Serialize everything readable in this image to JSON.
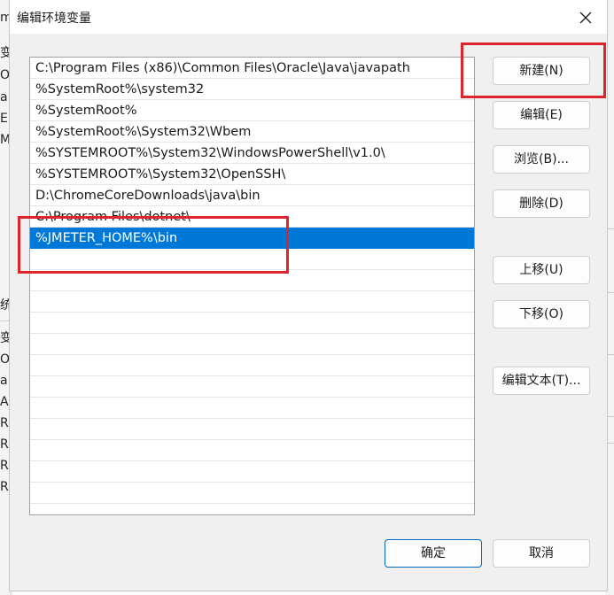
{
  "background_window": {
    "left_fragments": [
      "m",
      "变",
      "Or",
      "a",
      "E",
      "M",
      "统",
      "变",
      "OS",
      "a",
      "A",
      "R",
      "R",
      "R",
      "R"
    ]
  },
  "dialog": {
    "title": "编辑环境变量",
    "close_symbol": "✕"
  },
  "paths": [
    "C:\\Program Files (x86)\\Common Files\\Oracle\\Java\\javapath",
    "%SystemRoot%\\system32",
    "%SystemRoot%",
    "%SystemRoot%\\System32\\Wbem",
    "%SYSTEMROOT%\\System32\\WindowsPowerShell\\v1.0\\",
    "%SYSTEMROOT%\\System32\\OpenSSH\\",
    "D:\\ChromeCoreDownloads\\java\\bin",
    "C:\\Program Files\\dotnet\\",
    "%JMETER_HOME%\\bin"
  ],
  "selected_index": 8,
  "buttons": {
    "new": "新建(N)",
    "edit": "编辑(E)",
    "browse": "浏览(B)...",
    "delete": "删除(D)",
    "move_up": "上移(U)",
    "move_down": "下移(O)",
    "edit_text": "编辑文本(T)...",
    "ok": "确定",
    "cancel": "取消"
  },
  "colors": {
    "selection": "#0078d7",
    "annotation": "#e0242b",
    "primary_border": "#0067c0"
  }
}
